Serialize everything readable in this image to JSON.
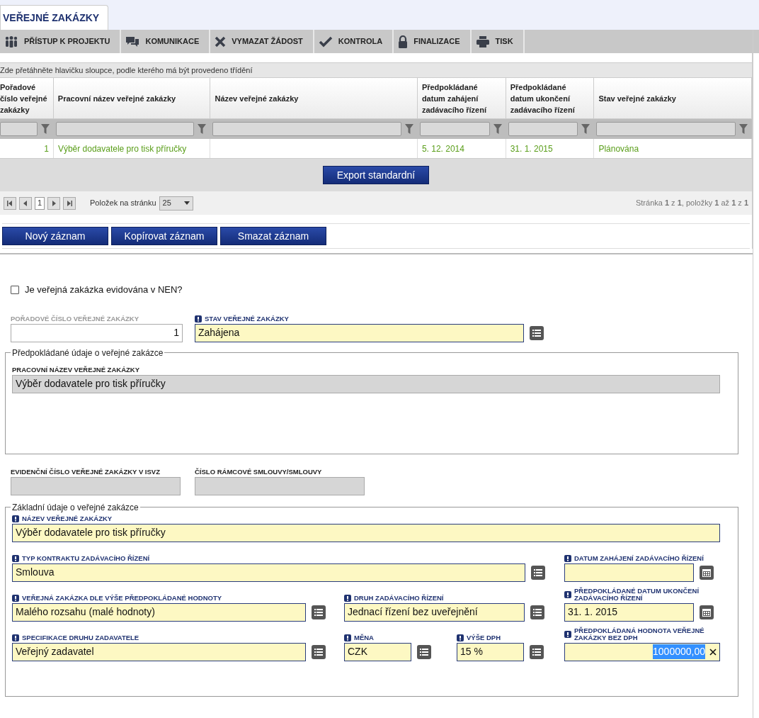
{
  "tabs": [
    {
      "label": "VEŘEJNÉ ZAKÁZKY",
      "selected": true
    }
  ],
  "toolbar": [
    {
      "label": "PŘÍSTUP K PROJEKTU",
      "kind": "people"
    },
    {
      "label": "KOMUNIKACE",
      "kind": "chat"
    },
    {
      "label": "VYMAZAT ŽÁDOST",
      "kind": "cross"
    },
    {
      "label": "KONTROLA",
      "kind": "check"
    },
    {
      "label": "FINALIZACE",
      "kind": "lock"
    },
    {
      "label": "TISK",
      "kind": "print"
    }
  ],
  "grid": {
    "group_hint": "Zde přetáhněte hlavičku sloupce, podle kterého má být provedeno třídění",
    "columns": [
      {
        "label": "Pořadové číslo veřejné zakázky"
      },
      {
        "label": "Pracovní název veřejné zakázky"
      },
      {
        "label": "Název veřejné zakázky"
      },
      {
        "label": "Předpokládané datum zahájení zadávacího řízení"
      },
      {
        "label": "Předpokládané datum ukončení zadávacího řízení"
      },
      {
        "label": "Stav veřejné zakázky"
      }
    ],
    "rows": [
      {
        "cells": [
          "1",
          "Výběr dodavatele pro tisk příručky",
          "",
          "5. 12. 2014",
          "31. 1. 2015",
          "Plánována"
        ]
      }
    ],
    "export_button": "Export standardní",
    "pager": {
      "page": "1",
      "page_size_label": "Položek na stránku",
      "page_size": "25",
      "summary": "Stránka **1** z **1**, položky **1** až **1** z **1**"
    }
  },
  "actions": [
    "Nový záznam",
    "Kopírovat záznam",
    "Smazat záznam"
  ],
  "form": {
    "nen_checkbox": {
      "label": "Je veřejná zakázka evidována v NEN?",
      "checked": false
    },
    "top_row": [
      {
        "label": "POŘADOVÉ ČÍSLO VEŘEJNÉ ZAKÁZKY",
        "value": "1",
        "required": false,
        "kind": "number"
      },
      {
        "label": "STAV VEŘEJNÉ ZAKÁZKY",
        "value": "Zahájena",
        "required": true,
        "kind": "select"
      }
    ],
    "expected": {
      "legend": "Předpokládané údaje o veřejné zakázce",
      "fields": [
        {
          "label": "PRACOVNÍ NÁZEV VEŘEJNÉ ZAKÁZKY",
          "value": "Výběr dodavatele pro tisk příručky",
          "required": false,
          "kind": "readonly"
        }
      ]
    },
    "register_row": [
      {
        "label": "EVIDENČNÍ ČÍSLO VEŘEJNÉ ZAKÁZKY V ISVZ",
        "required": false,
        "kind": "readonly"
      },
      {
        "label": "ČÍSLO RÁMCOVÉ SMLOUVY/SMLOUVY",
        "required": false,
        "kind": "readonly"
      }
    ],
    "basic": {
      "legend": "Základní údaje o veřejné zakázce",
      "name_field": {
        "label": "NÁZEV VEŘEJNÉ ZAKÁZKY",
        "value": "Výběr dodavatele pro tisk příručky",
        "required": true,
        "kind": "text"
      },
      "left_rows": [
        [
          {
            "label": "TYP KONTRAKTU ZADÁVACÍHO ŘÍZENÍ",
            "value": "Smlouva",
            "required": true,
            "kind": "select"
          }
        ],
        [
          {
            "label": "VEŘEJNÁ ZAKÁZKA DLE VÝŠE PŘEDPOKLÁDANÉ HODNOTY",
            "value": "Malého rozsahu (malé hodnoty)",
            "required": true,
            "kind": "select"
          },
          {
            "label": "DRUH ZADÁVACÍHO ŘÍZENÍ",
            "value": "Jednací řízení bez uveřejnění",
            "required": true,
            "kind": "select"
          }
        ],
        [
          {
            "label": "SPECIFIKACE DRUHU ZADAVATELE",
            "value": "Veřejný zadavatel",
            "required": true,
            "kind": "select"
          },
          {
            "label": "MĚNA",
            "value": "CZK",
            "required": true,
            "kind": "select"
          },
          {
            "label": "VÝŠE DPH",
            "value": "15 %",
            "required": true,
            "kind": "select"
          }
        ]
      ],
      "right_column": [
        {
          "label": "DATUM ZAHÁJENÍ ZADÁVACÍHO ŘÍZENÍ",
          "required": true,
          "kind": "date"
        },
        {
          "label": "PŘEDPOKLÁDANÉ DATUM UKONČENÍ ZADÁVACÍHO ŘÍZENÍ",
          "value": "31. 1. 2015",
          "required": true,
          "kind": "date"
        },
        {
          "label": "PŘEDPOKLÁDANÁ HODNOTA VEŘEJNÉ ZAKÁZKY BEZ DPH",
          "value": "1000000,00",
          "required": true,
          "kind": "clear",
          "text_selected": true
        }
      ]
    }
  }
}
